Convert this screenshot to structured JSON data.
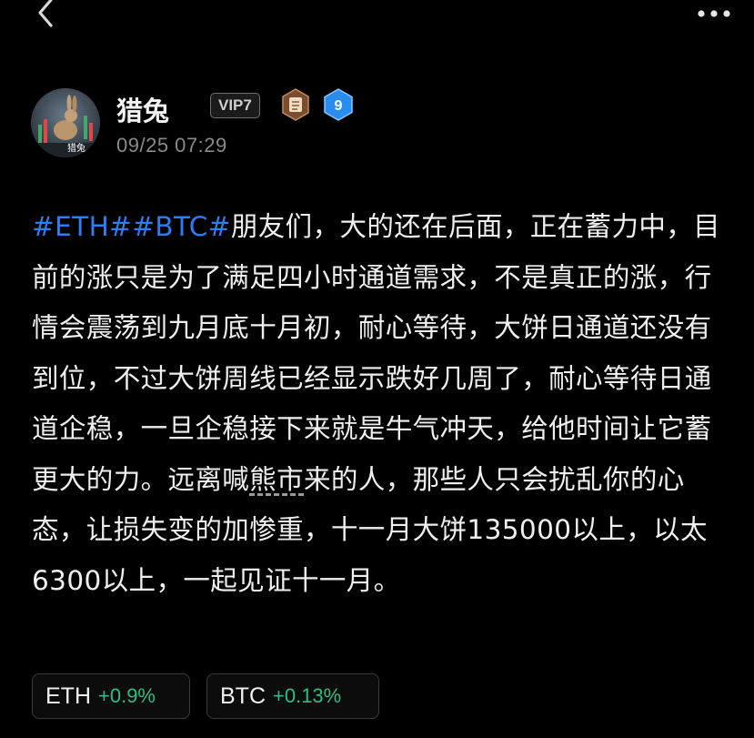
{
  "topbar": {
    "back_icon": "chevron-left-icon",
    "more_icon": "more-horizontal-icon"
  },
  "author": {
    "name": "猎兔",
    "vip_label": "VIP7",
    "level_value": "9",
    "avatar_caption": "猎兔",
    "post_time": "09/25 07:29",
    "badge_colors": {
      "level": "#2b8cf0",
      "scroll": "#a9693f"
    }
  },
  "post": {
    "hashtag_1": "#ETH#",
    "hashtag_2": "#BTC#",
    "text_a": "朋友们，大的还在后面，正在蓄力中，目前的涨只是为了满足四小时通道需求，不是真正的涨，行情会震荡到九月底十月初，耐心等待，大饼日通道还没有到位，不过大饼周线已经显示跌好几周了，耐心等待日通道企稳，一旦企稳接下来就是牛气冲天，给他时间让它蓄更大的力。远离喊",
    "keyword": "熊市",
    "text_b": "来的人，那些人只会扰乱你的心态，让损失变的加惨重，十一月大饼135000以上，以太6300以上，一起见证十一月。"
  },
  "tickers": [
    {
      "symbol": "ETH",
      "change": "+0.9%",
      "color": "#2ebd85"
    },
    {
      "symbol": "BTC",
      "change": "+0.13%",
      "color": "#2ebd85"
    }
  ]
}
